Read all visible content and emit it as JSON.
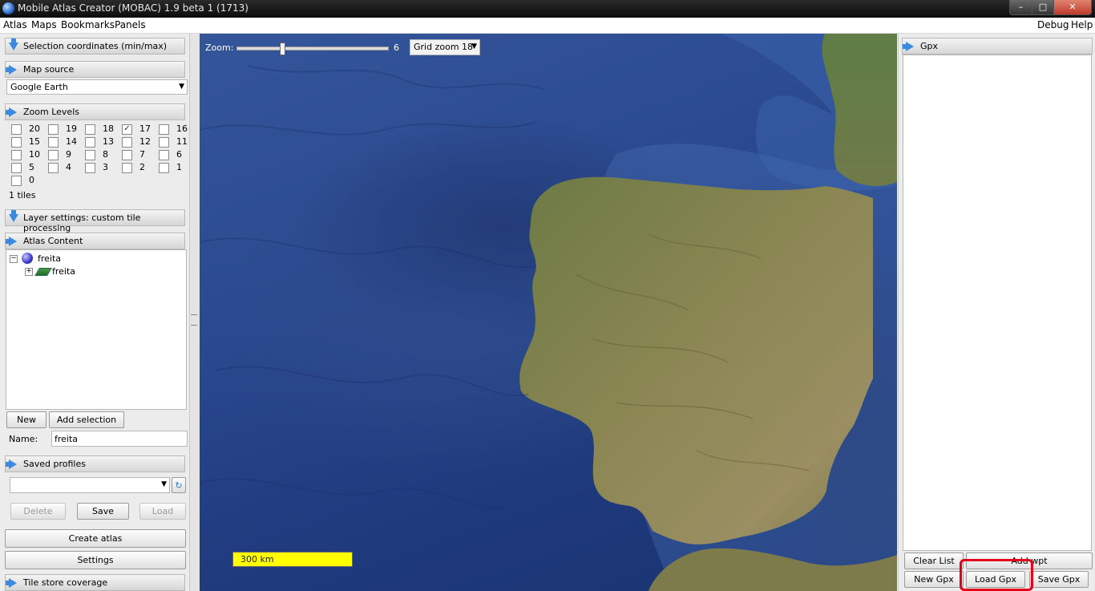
{
  "window": {
    "title": "Mobile Atlas Creator (MOBAC) 1.9 beta 1 (1713)"
  },
  "menubar": {
    "atlas": "Atlas",
    "maps": "Maps",
    "bookmarks": "Bookmarks",
    "panels": "Panels",
    "debug": "Debug",
    "help": "Help"
  },
  "left": {
    "selection_coords": "Selection coordinates (min/max)",
    "map_source": {
      "title": "Map source",
      "value": "Google Earth"
    },
    "zoom_levels": {
      "title": "Zoom Levels",
      "levels": [
        {
          "n": "20",
          "checked": false
        },
        {
          "n": "19",
          "checked": false
        },
        {
          "n": "18",
          "checked": false
        },
        {
          "n": "17",
          "checked": true
        },
        {
          "n": "16",
          "checked": false
        },
        {
          "n": "15",
          "checked": false
        },
        {
          "n": "14",
          "checked": false
        },
        {
          "n": "13",
          "checked": false
        },
        {
          "n": "12",
          "checked": false
        },
        {
          "n": "11",
          "checked": false
        },
        {
          "n": "10",
          "checked": false
        },
        {
          "n": "9",
          "checked": false
        },
        {
          "n": "8",
          "checked": false
        },
        {
          "n": "7",
          "checked": false
        },
        {
          "n": "6",
          "checked": false
        },
        {
          "n": "5",
          "checked": false
        },
        {
          "n": "4",
          "checked": false
        },
        {
          "n": "3",
          "checked": false
        },
        {
          "n": "2",
          "checked": false
        },
        {
          "n": "1",
          "checked": false
        },
        {
          "n": "0",
          "checked": false
        }
      ],
      "tiles": "1 tiles"
    },
    "layer_settings": "Layer settings: custom tile processing",
    "atlas_content": {
      "title": "Atlas Content",
      "root": "freita",
      "child": "freita"
    },
    "new_label": "New",
    "add_selection_label": "Add selection",
    "name_label": "Name:",
    "name_value": "freita",
    "saved_profiles": {
      "title": "Saved profiles",
      "value": ""
    },
    "delete_label": "Delete",
    "save_label": "Save",
    "load_label": "Load",
    "create_atlas_label": "Create atlas",
    "settings_label": "Settings",
    "tile_store": "Tile store coverage"
  },
  "map": {
    "zoom_label": "Zoom:",
    "zoom_value": "6",
    "zoom_fraction": 0.3,
    "grid_zoom": "Grid zoom 18",
    "scale": "300 km",
    "colors": {
      "scale_bg": "#ffff00",
      "land": "#7a7a45"
    }
  },
  "right": {
    "gpx_title": "Gpx",
    "clear_list_label": "Clear List",
    "add_wpt_label": "Add wpt",
    "new_gpx_label": "New Gpx",
    "load_gpx_label": "Load Gpx",
    "save_gpx_label": "Save Gpx",
    "highlight_color": "#e3001b"
  }
}
